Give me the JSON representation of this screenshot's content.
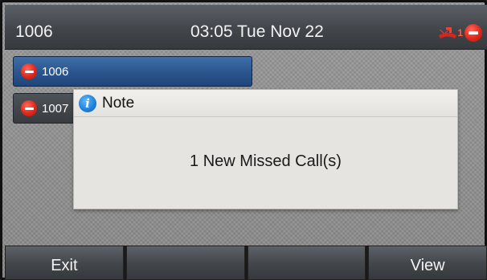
{
  "status_bar": {
    "account": "1006",
    "datetime": "03:05 Tue Nov 22",
    "missed_count": "1",
    "icons": [
      "missed-call-icon",
      "dnd-icon"
    ]
  },
  "line_keys": [
    {
      "label": "1006",
      "selected": true,
      "icon": "dnd-icon"
    },
    {
      "label": "1007",
      "selected": false,
      "icon": "dnd-icon"
    }
  ],
  "dialog": {
    "icon": "info-icon",
    "title": "Note",
    "message": "1 New Missed Call(s)"
  },
  "softkeys": [
    {
      "label": "Exit"
    },
    {
      "label": ""
    },
    {
      "label": ""
    },
    {
      "label": "View"
    }
  ],
  "colors": {
    "status_bar": "#42464b",
    "selected_line": "#2a558c",
    "dnd_red": "#e0271b",
    "info_blue": "#1e7fd8",
    "dialog_bg": "#e6e4e0"
  }
}
